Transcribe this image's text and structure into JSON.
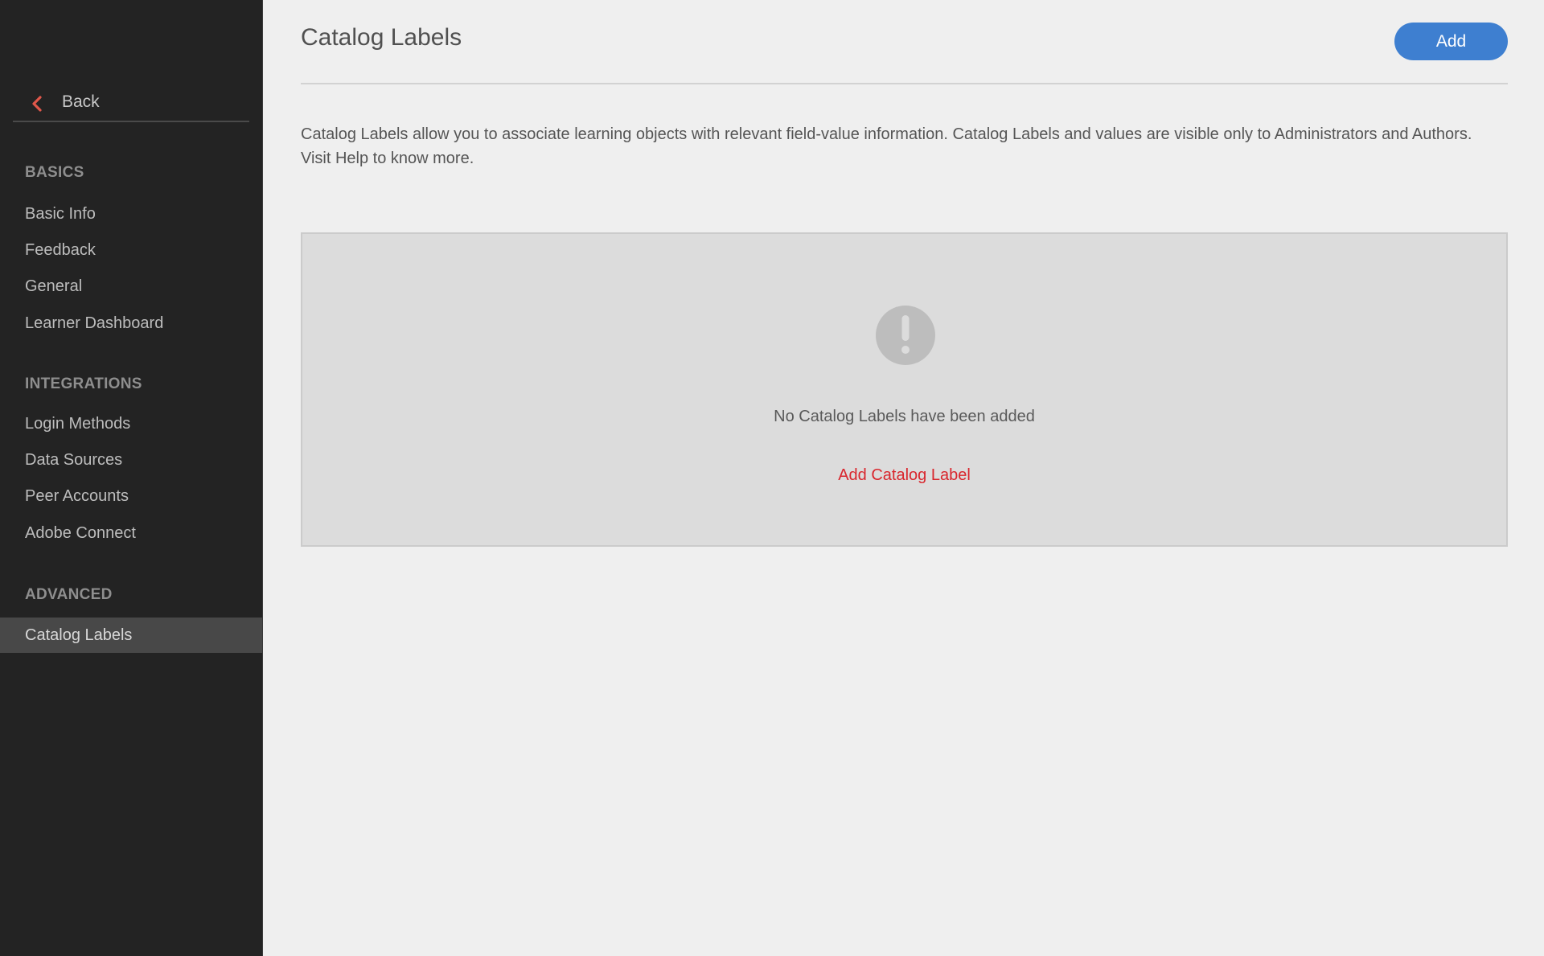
{
  "sidebar": {
    "back_label": "Back",
    "back_icon": "chevron-left-icon",
    "sections": [
      {
        "title": "BASICS",
        "items": [
          {
            "label": "Basic Info"
          },
          {
            "label": "Feedback"
          },
          {
            "label": "General"
          },
          {
            "label": "Learner Dashboard"
          }
        ]
      },
      {
        "title": "INTEGRATIONS",
        "items": [
          {
            "label": "Login Methods"
          },
          {
            "label": "Data Sources"
          },
          {
            "label": "Peer Accounts"
          },
          {
            "label": "Adobe Connect"
          }
        ]
      },
      {
        "title": "ADVANCED",
        "items": [
          {
            "label": "Catalog Labels",
            "active": true
          }
        ]
      }
    ]
  },
  "header": {
    "title": "Catalog Labels",
    "add_label": "Add"
  },
  "description": {
    "line1": "Catalog Labels allow you to associate learning objects with relevant field-value information. Catalog Labels and values are visible only to Administrators and Authors.",
    "line2": "Visit Help to know more."
  },
  "empty_state": {
    "icon": "exclamation-circle-icon",
    "message": "No Catalog Labels have been added",
    "action_label": "Add Catalog Label"
  },
  "colors": {
    "accent_blue": "#3e7fd0",
    "link_red": "#d9262d",
    "back_chevron": "#e0574a",
    "sidebar_bg": "#232323",
    "active_item_bg": "#484848"
  }
}
